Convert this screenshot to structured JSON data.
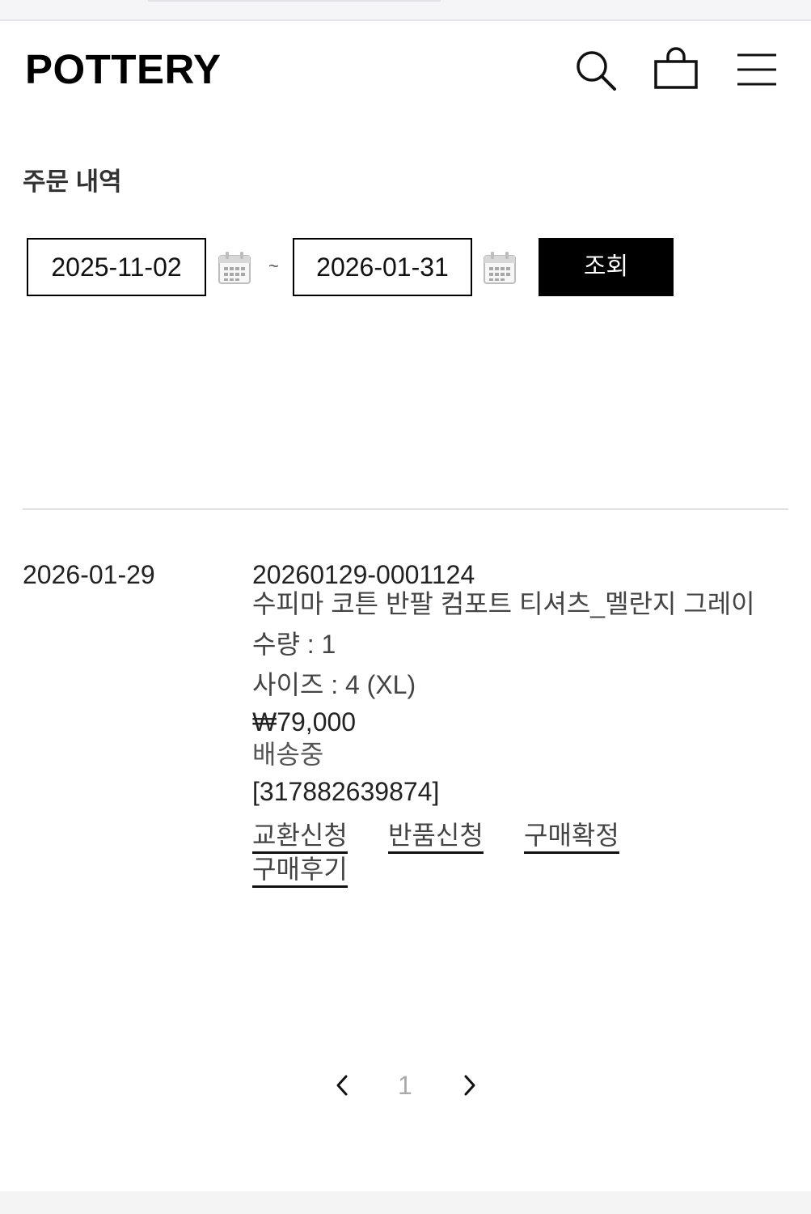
{
  "header": {
    "logo": "POTTERY",
    "icons": [
      "search-icon",
      "shopping-bag-icon",
      "menu-icon"
    ]
  },
  "page": {
    "title": "주문 내역"
  },
  "filter": {
    "start_date": "2025-11-02",
    "end_date": "2026-01-31",
    "separator": "~",
    "search_label": "조회"
  },
  "orders": [
    {
      "date": "2026-01-29",
      "order_number": "20260129-0001124",
      "product_name": "수피마 코튼 반팔 컴포트 티셔츠_멜란지 그레이",
      "quantity": "수량 : 1",
      "size": "사이즈 : 4 (XL)",
      "price": "₩79,000",
      "status": "배송중",
      "tracking": "[317882639874]",
      "actions": {
        "exchange": "교환신청",
        "return": "반품신청",
        "confirm": "구매확정",
        "review": "구매후기"
      }
    }
  ],
  "pagination": {
    "current_page": "1"
  },
  "colors": {
    "primary": "#000000",
    "button_text": "#ffffff",
    "divider": "#e2e2e2",
    "page_number_inactive": "#aaaaaa"
  }
}
